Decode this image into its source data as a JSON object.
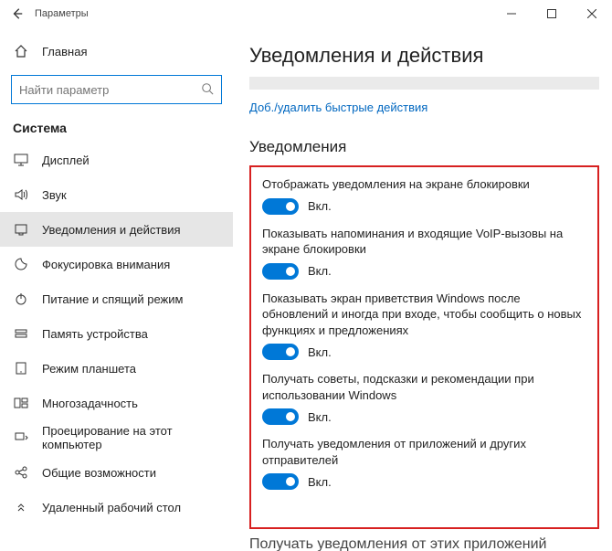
{
  "window": {
    "title": "Параметры"
  },
  "sidebar": {
    "home_label": "Главная",
    "search_placeholder": "Найти параметр",
    "category": "Система",
    "items": [
      {
        "label": "Дисплей",
        "icon": "display-icon"
      },
      {
        "label": "Звук",
        "icon": "sound-icon"
      },
      {
        "label": "Уведомления и действия",
        "icon": "notifications-icon"
      },
      {
        "label": "Фокусировка внимания",
        "icon": "focus-icon"
      },
      {
        "label": "Питание и спящий режим",
        "icon": "power-icon"
      },
      {
        "label": "Память устройства",
        "icon": "storage-icon"
      },
      {
        "label": "Режим планшета",
        "icon": "tablet-icon"
      },
      {
        "label": "Многозадачность",
        "icon": "multitask-icon"
      },
      {
        "label": "Проецирование на этот компьютер",
        "icon": "project-icon"
      },
      {
        "label": "Общие возможности",
        "icon": "shared-icon"
      },
      {
        "label": "Удаленный рабочий стол",
        "icon": "remote-icon"
      }
    ],
    "active_index": 2
  },
  "page": {
    "title": "Уведомления и действия",
    "quick_actions_link": "Доб./удалить быстрые действия",
    "section_title": "Уведомления",
    "toggle_on_label": "Вкл.",
    "settings": [
      {
        "label": "Отображать уведомления на экране блокировки",
        "on": true
      },
      {
        "label": "Показывать напоминания и входящие VoIP-вызовы на экране блокировки",
        "on": true
      },
      {
        "label": "Показывать экран приветствия Windows после обновлений и иногда при входе, чтобы сообщить о новых функциях и предложениях",
        "on": true
      },
      {
        "label": "Получать советы, подсказки и рекомендации при использовании Windows",
        "on": true
      },
      {
        "label": "Получать уведомления от приложений и других отправителей",
        "on": true
      }
    ],
    "cutoff_heading": "Получать уведомления от этих приложений"
  }
}
